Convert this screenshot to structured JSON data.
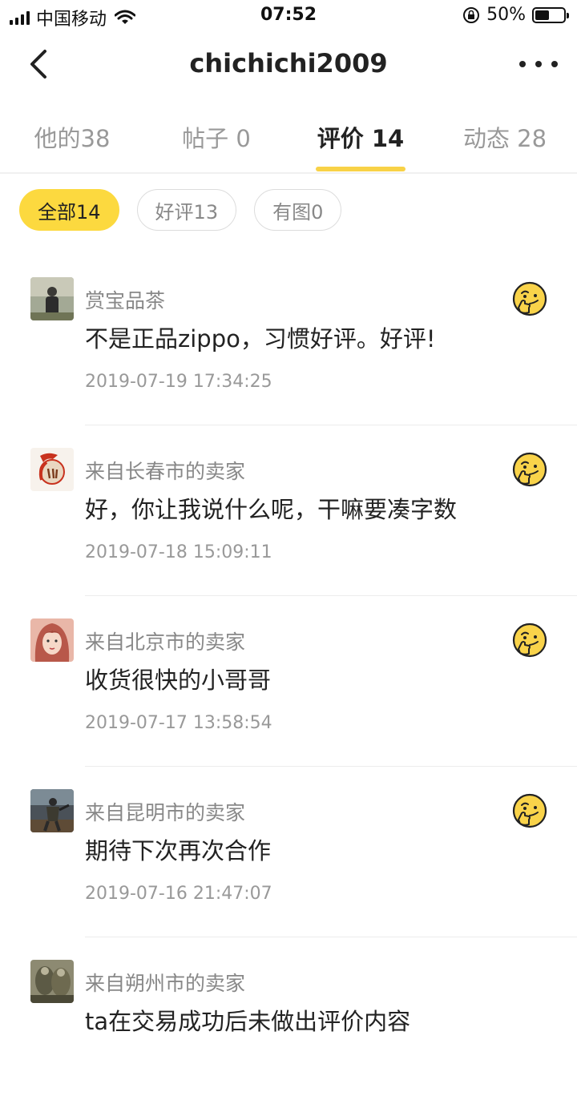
{
  "status_bar": {
    "carrier": "中国移动",
    "time": "07:52",
    "battery_text": "50%",
    "battery_level": 0.5
  },
  "nav": {
    "title": "chichichi2009",
    "back_icon": "chevron-left-icon",
    "more_icon": "more-dots-icon"
  },
  "tabs": [
    {
      "label": "他的38",
      "active": false
    },
    {
      "label": "帖子 0",
      "active": false
    },
    {
      "label": "评价 14",
      "active": true
    },
    {
      "label": "动态 28",
      "active": false
    }
  ],
  "filters": [
    {
      "label": "全部14",
      "active": true
    },
    {
      "label": "好评13",
      "active": false
    },
    {
      "label": "有图0",
      "active": false
    }
  ],
  "colors": {
    "accent": "#fcd93f",
    "tab_indicator": "#f8d247",
    "emoji": "#f9d34a"
  },
  "reviews": [
    {
      "name": "赏宝品茶",
      "content": "不是正品zippo，习惯好评。好评!",
      "time": "2019-07-19 17:34:25",
      "rating_icon": "thinking-emoji-icon"
    },
    {
      "name": "来自长春市的卖家",
      "content": "好，你让我说什么呢，干嘛要凑字数",
      "time": "2019-07-18 15:09:11",
      "rating_icon": "thinking-emoji-icon"
    },
    {
      "name": "来自北京市的卖家",
      "content": "收货很快的小哥哥",
      "time": "2019-07-17 13:58:54",
      "rating_icon": "thinking-emoji-icon"
    },
    {
      "name": "来自昆明市的卖家",
      "content": "期待下次再次合作",
      "time": "2019-07-16 21:47:07",
      "rating_icon": "thinking-emoji-icon"
    },
    {
      "name": "来自朔州市的卖家",
      "content": "ta在交易成功后未做出评价内容",
      "time": "",
      "rating_icon": ""
    }
  ]
}
